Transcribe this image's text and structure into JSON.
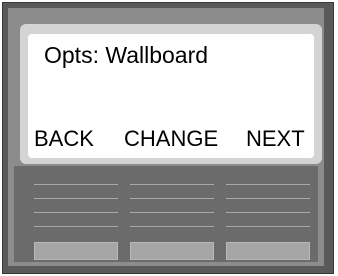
{
  "display": {
    "title": "Opts: Wallboard",
    "softkeys": [
      {
        "label": "BACK"
      },
      {
        "label": "CHANGE"
      },
      {
        "label": "NEXT"
      }
    ]
  },
  "colors": {
    "bezel_dark": "#5a5a5a",
    "bezel_mid": "#8c8c8c",
    "panel": "#6b6b6b",
    "screen_border": "#d4d4d4",
    "screen_bg": "#ffffff",
    "button": "#a5a5a5",
    "text": "#000000"
  }
}
